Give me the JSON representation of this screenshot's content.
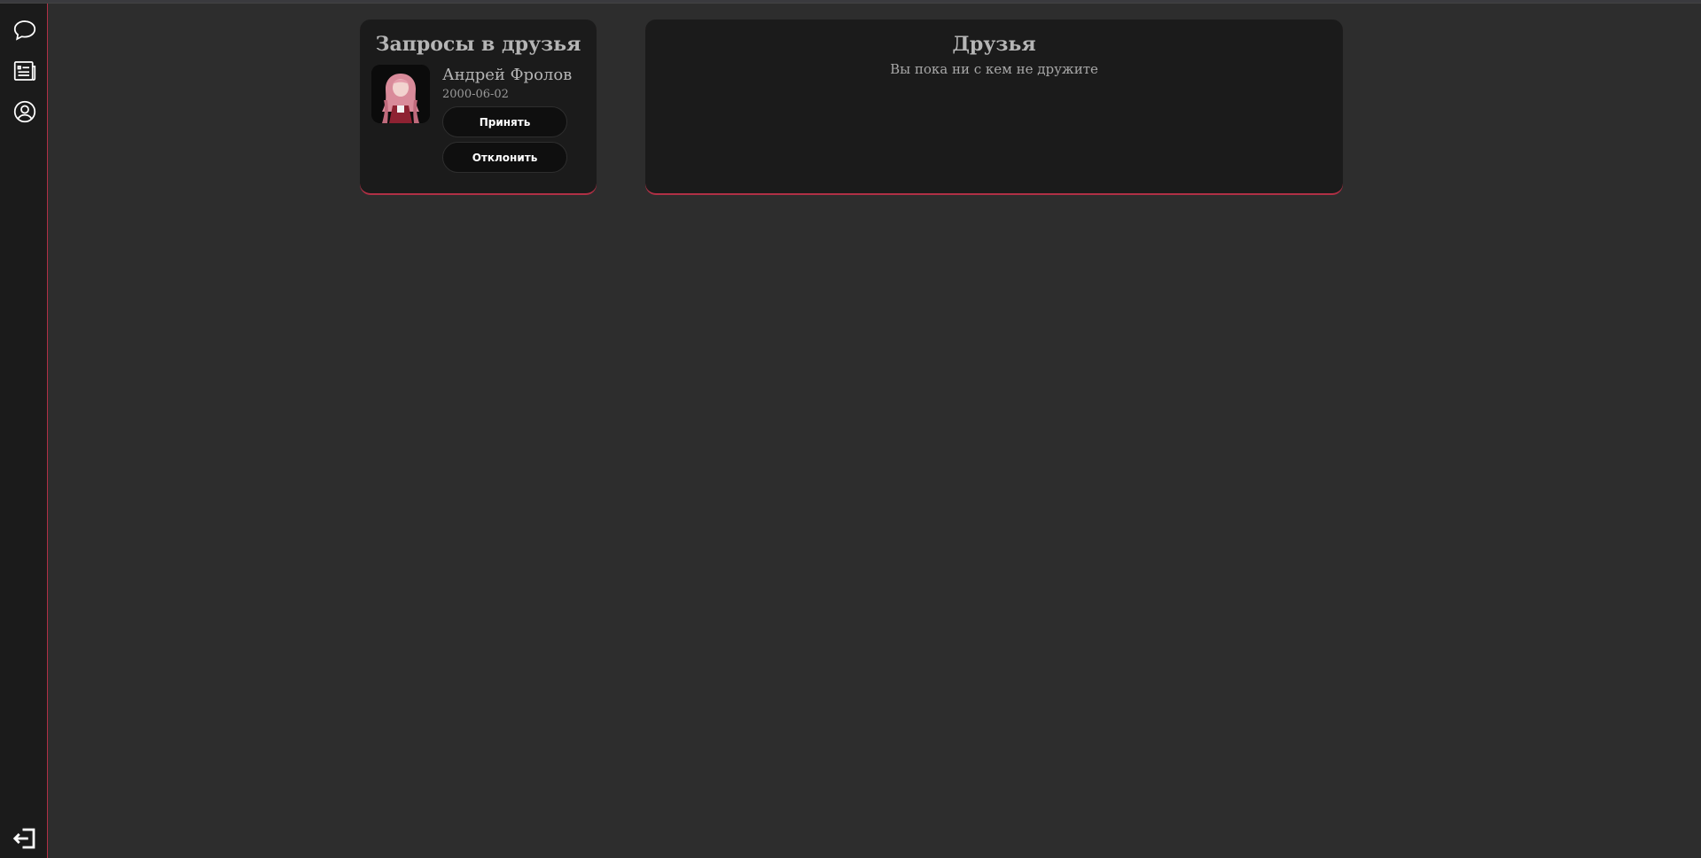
{
  "sidebar": {
    "items": [
      {
        "icon": "chat-bubble-icon"
      },
      {
        "icon": "news-list-icon"
      },
      {
        "icon": "user-circle-icon"
      }
    ],
    "logout_icon": "logout-icon"
  },
  "requests": {
    "title": "Запросы в друзья",
    "items": [
      {
        "name": "Андрей Фролов",
        "date": "2000-06-02",
        "accept_label": "Принять",
        "decline_label": "Отклонить"
      }
    ]
  },
  "friends": {
    "title": "Друзья",
    "empty_text": "Вы пока ни с кем не дружите"
  },
  "colors": {
    "background": "#2d2d2d",
    "panel": "#1b1b1b",
    "accent": "#b03045"
  }
}
